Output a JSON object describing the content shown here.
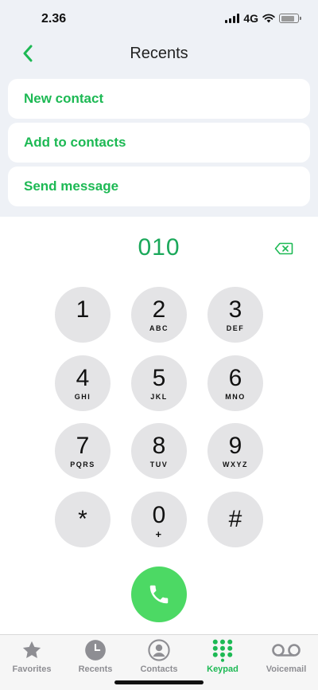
{
  "status_bar": {
    "time": "2.36",
    "network": "4G",
    "battery_level": 0.8
  },
  "nav": {
    "title": "Recents"
  },
  "actions": [
    {
      "label": "New contact"
    },
    {
      "label": "Add to contacts"
    },
    {
      "label": "Send message"
    }
  ],
  "dial": {
    "number": "010"
  },
  "keypad": [
    {
      "digit": "1",
      "letters": ""
    },
    {
      "digit": "2",
      "letters": "ABC"
    },
    {
      "digit": "3",
      "letters": "DEF"
    },
    {
      "digit": "4",
      "letters": "GHI"
    },
    {
      "digit": "5",
      "letters": "JKL"
    },
    {
      "digit": "6",
      "letters": "MNO"
    },
    {
      "digit": "7",
      "letters": "PQRS"
    },
    {
      "digit": "8",
      "letters": "TUV"
    },
    {
      "digit": "9",
      "letters": "WXYZ"
    },
    {
      "digit": "*",
      "letters": ""
    },
    {
      "digit": "0",
      "letters": "+"
    },
    {
      "digit": "#",
      "letters": ""
    }
  ],
  "tabs": [
    {
      "label": "Favorites",
      "icon": "star-icon",
      "active": false
    },
    {
      "label": "Recents",
      "icon": "clock-icon",
      "active": false
    },
    {
      "label": "Contacts",
      "icon": "person-circle-icon",
      "active": false
    },
    {
      "label": "Keypad",
      "icon": "keypad-icon",
      "active": true
    },
    {
      "label": "Voicemail",
      "icon": "voicemail-icon",
      "active": false
    }
  ],
  "colors": {
    "accent": "#1db954",
    "number_text": "#1aa85a",
    "call_button": "#4cd964",
    "key_background": "#e4e4e6",
    "header_background": "#eef1f6",
    "inactive_tab": "#8e8e93"
  }
}
